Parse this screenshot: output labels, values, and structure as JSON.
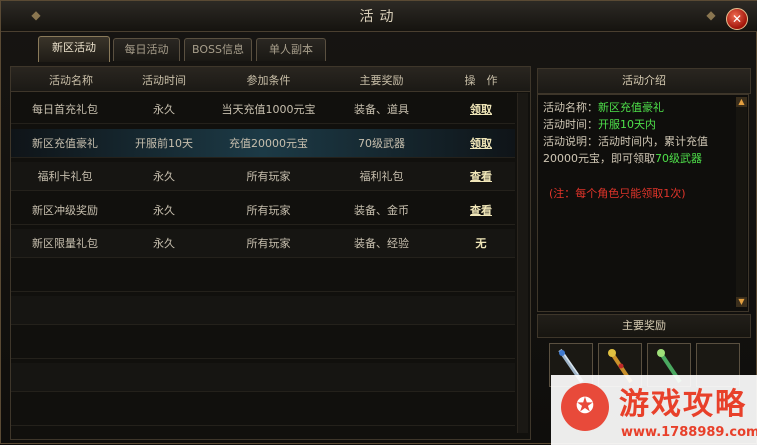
{
  "window": {
    "title": "活动",
    "close_symbol": "✕"
  },
  "tabs": [
    {
      "label": "新区活动",
      "active": true
    },
    {
      "label": "每日活动",
      "active": false
    },
    {
      "label": "BOSS信息",
      "active": false
    },
    {
      "label": "单人副本",
      "active": false
    }
  ],
  "table": {
    "headers": [
      "活动名称",
      "活动时间",
      "参加条件",
      "主要奖励",
      "操　作"
    ],
    "rows": [
      {
        "name": "每日首充礼包",
        "time": "永久",
        "condition": "当天充值1000元宝",
        "reward": "装备、道具",
        "action": "领取",
        "action_type": "link"
      },
      {
        "name": "新区充值豪礼",
        "time": "开服前10天",
        "condition": "充值20000元宝",
        "reward": "70级武器",
        "action": "领取",
        "action_type": "link",
        "selected": true
      },
      {
        "name": "福利卡礼包",
        "time": "永久",
        "condition": "所有玩家",
        "reward": "福利礼包",
        "action": "查看",
        "action_type": "link"
      },
      {
        "name": "新区冲级奖励",
        "time": "永久",
        "condition": "所有玩家",
        "reward": "装备、金币",
        "action": "查看",
        "action_type": "link"
      },
      {
        "name": "新区限量礼包",
        "time": "永久",
        "condition": "所有玩家",
        "reward": "装备、经验",
        "action": "无",
        "action_type": "plain"
      }
    ]
  },
  "intro": {
    "title": "活动介绍",
    "name_label": "活动名称：",
    "name_value": "新区充值豪礼",
    "time_label": "活动时间：",
    "time_value": "开服10天内",
    "desc_label": "活动说明：",
    "desc_text": "活动时间内，累计充值20000元宝，即可领取",
    "desc_highlight": "70级武器",
    "note": "(注：每个角色只能领取1次)"
  },
  "rewards": {
    "title": "主要奖励",
    "items": [
      "sword-icon",
      "staff-icon",
      "wand-icon",
      "empty-slot"
    ]
  },
  "watermark": {
    "title": "游戏攻略",
    "url": "www.1788989.com"
  },
  "colors": {
    "highlight_green": "#4ee04a",
    "note_red": "#e0342a",
    "selected_row": "#1c3a46"
  }
}
